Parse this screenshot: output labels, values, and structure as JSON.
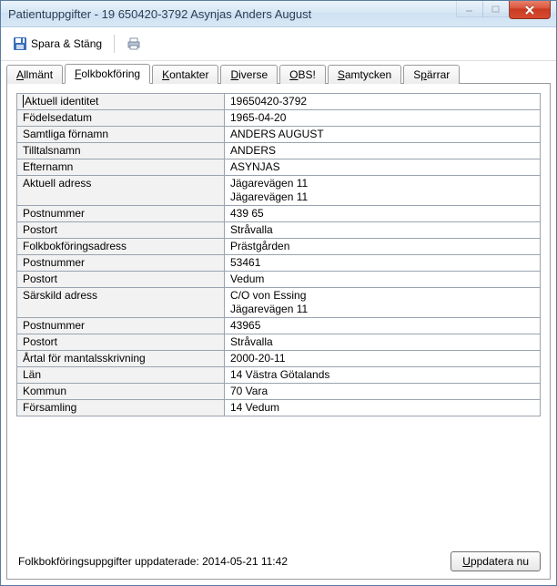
{
  "window": {
    "title": "Patientuppgifter - 19  650420-3792 Asynjas Anders August"
  },
  "toolbar": {
    "save_close_label": "Spara & Stäng"
  },
  "tabs": {
    "allmant": "Allmänt",
    "folkbokforing": "Folkbokföring",
    "kontakter": "Kontakter",
    "diverse": "Diverse",
    "obs": "OBS!",
    "samtycken": "Samtycken",
    "sparrar": "Spärrar"
  },
  "fields": {
    "aktuell_identitet": {
      "label": "Aktuell identitet",
      "value": "19650420-3792"
    },
    "fodelsedatum": {
      "label": "Födelsedatum",
      "value": "1965-04-20"
    },
    "samtliga_fornamn": {
      "label": "Samtliga förnamn",
      "value": "ANDERS AUGUST"
    },
    "tilltalsnamn": {
      "label": "Tilltalsnamn",
      "value": "ANDERS"
    },
    "efternamn": {
      "label": "Efternamn",
      "value": "ASYNJAS"
    },
    "aktuell_adress": {
      "label": "Aktuell adress",
      "value": "Jägarevägen 11\nJägarevägen 11"
    },
    "postnummer1": {
      "label": "Postnummer",
      "value": "439 65"
    },
    "postort1": {
      "label": "Postort",
      "value": "Stråvalla"
    },
    "folkbokforingsadress": {
      "label": "Folkbokföringsadress",
      "value": "Prästgården"
    },
    "postnummer2": {
      "label": "Postnummer",
      "value": "53461"
    },
    "postort2": {
      "label": "Postort",
      "value": "Vedum"
    },
    "sarskild_adress": {
      "label": "Särskild adress",
      "value": "C/O von Essing\nJägarevägen 11"
    },
    "postnummer3": {
      "label": "Postnummer",
      "value": "43965"
    },
    "postort3": {
      "label": "Postort",
      "value": "Stråvalla"
    },
    "artal_mantalsskrivning": {
      "label": "Årtal för mantalsskrivning",
      "value": "2000-20-11"
    },
    "lan": {
      "label": "Län",
      "value": "14 Västra Götalands"
    },
    "kommun": {
      "label": "Kommun",
      "value": "70 Vara"
    },
    "forsamling": {
      "label": "Församling",
      "value": "14 Vedum"
    }
  },
  "footer": {
    "status": "Folkbokföringsuppgifter uppdaterade: 2014-05-21 11:42",
    "update_label": "Uppdatera nu"
  }
}
